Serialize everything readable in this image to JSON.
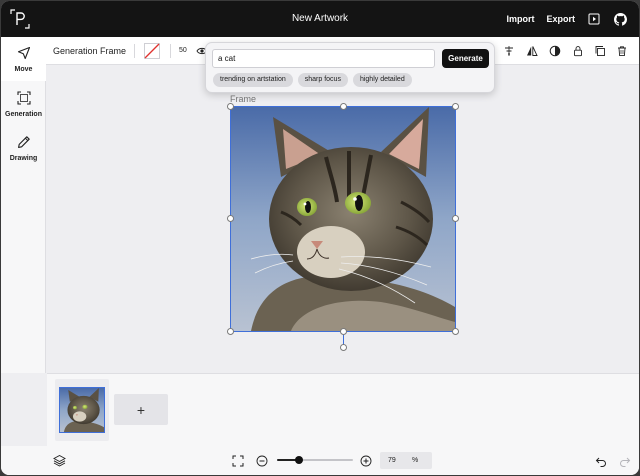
{
  "app": {
    "title": "New Artwork",
    "import_label": "Import",
    "export_label": "Export"
  },
  "tools": [
    {
      "label": "Move",
      "icon": "cursor-arrow-icon",
      "active": true
    },
    {
      "label": "Generation",
      "icon": "frame-corners-icon",
      "active": false
    },
    {
      "label": "Drawing",
      "icon": "pencil-icon",
      "active": false
    }
  ],
  "toolbar": {
    "title": "Generation Frame",
    "stroke_width": "50",
    "icons": [
      "eye-icon",
      "plus-icon",
      "filter-icon",
      "flip-icon",
      "contrast-icon",
      "lock-icon",
      "duplicate-icon",
      "trash-icon"
    ]
  },
  "prompt": {
    "value": "a cat",
    "placeholder": "",
    "generate_label": "Generate",
    "chips": [
      "trending on artstation",
      "sharp focus",
      "highly detailed"
    ]
  },
  "canvas": {
    "frame_label": "Frame"
  },
  "filmstrip": {
    "add_label": "+"
  },
  "status": {
    "zoom_value": "79",
    "zoom_unit": "%",
    "zoom_level": 0.29
  },
  "colors": {
    "accent": "#3f6fd9",
    "topbar": "#141414",
    "generate_button": "#111111"
  }
}
